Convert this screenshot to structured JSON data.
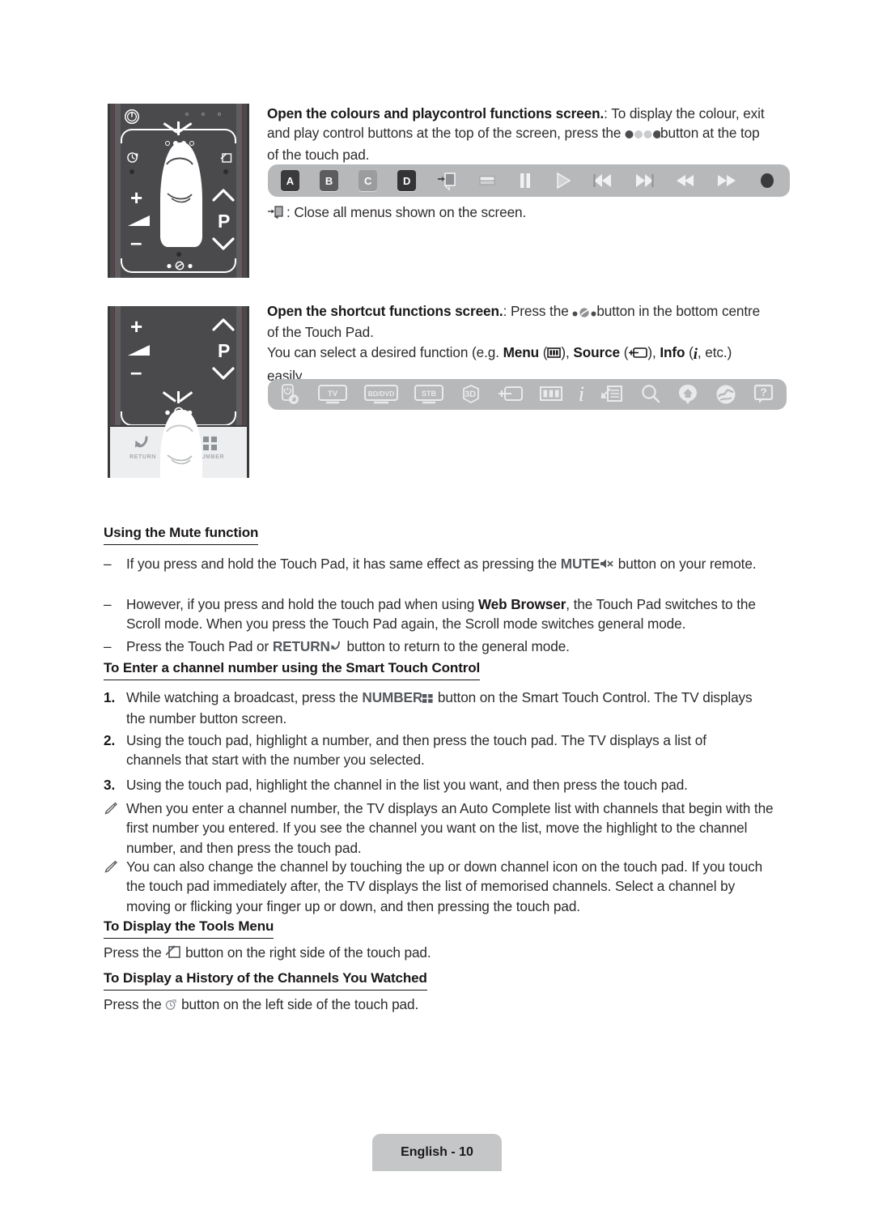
{
  "document": {
    "language": "English",
    "page_number": "10",
    "footer_label": "English - 10"
  },
  "sections": [
    {
      "id": "colours-playcontrol",
      "heading_bold": "Open the colours and playcontrol functions screen.",
      "text_after_heading": ": To display the colour, exit and play control buttons at the top of the screen, press the",
      "text_tail": "button at the top of the touch pad.",
      "inline_icon": "four-dot-button-icon",
      "note": ": Close all menus shown on the screen.",
      "note_icon": "exit-door-icon",
      "bar": {
        "name": "colours-and-playcontrol-bar",
        "items": [
          {
            "name": "button-a",
            "label": "A",
            "kind": "letter",
            "tone": "a"
          },
          {
            "name": "button-b",
            "label": "B",
            "kind": "letter",
            "tone": "b"
          },
          {
            "name": "button-c",
            "label": "C",
            "kind": "letter",
            "tone": "c"
          },
          {
            "name": "button-d",
            "label": "D",
            "kind": "letter",
            "tone": "d"
          },
          {
            "name": "exit-icon",
            "label": "",
            "kind": "exit"
          },
          {
            "name": "stop-icon",
            "label": "",
            "kind": "stop"
          },
          {
            "name": "pause-icon",
            "label": "",
            "kind": "pause"
          },
          {
            "name": "play-icon",
            "label": "",
            "kind": "play"
          },
          {
            "name": "previous-icon",
            "label": "",
            "kind": "prev"
          },
          {
            "name": "next-icon",
            "label": "",
            "kind": "next"
          },
          {
            "name": "rewind-icon",
            "label": "",
            "kind": "rew"
          },
          {
            "name": "fast-forward-icon",
            "label": "",
            "kind": "ff"
          },
          {
            "name": "record-icon",
            "label": "",
            "kind": "record"
          }
        ]
      }
    },
    {
      "id": "shortcut-functions",
      "heading_bold": "Open the shortcut functions screen.",
      "text_after_heading": ": Press the",
      "text_tail": "button in the bottom centre of the Touch Pad.",
      "inline_icon": "three-dot-button-icon",
      "line2_a": "You can select a desired function (e.g. ",
      "line2_menu": "Menu",
      "line2_menu_icon": "menu-icon",
      "line2_source": "Source",
      "line2_source_icon": "source-icon",
      "line2_info": "Info",
      "line2_info_icon": "info-icon",
      "line2_tail": ", etc.) easily.",
      "bar": {
        "name": "shortcut-functions-bar",
        "items": [
          {
            "name": "power-settings-icon",
            "label": "",
            "kind": "powerset"
          },
          {
            "name": "tv-icon",
            "label": "TV",
            "kind": "device"
          },
          {
            "name": "bd-dvd-icon",
            "label": "BD/DVD",
            "kind": "device"
          },
          {
            "name": "stb-icon",
            "label": "STB",
            "kind": "device"
          },
          {
            "name": "three-d-icon",
            "label": "3D",
            "kind": "threed"
          },
          {
            "name": "source-icon",
            "label": "",
            "kind": "source"
          },
          {
            "name": "menu-icon",
            "label": "",
            "kind": "menu"
          },
          {
            "name": "info-icon",
            "label": "i",
            "kind": "info"
          },
          {
            "name": "channel-list-icon",
            "label": "",
            "kind": "chlist"
          },
          {
            "name": "search-icon",
            "label": "",
            "kind": "search"
          },
          {
            "name": "smart-hub-icon",
            "label": "",
            "kind": "hub"
          },
          {
            "name": "web-browser-icon",
            "label": "",
            "kind": "web"
          },
          {
            "name": "support-help-icon",
            "label": "?",
            "kind": "help"
          }
        ]
      }
    }
  ],
  "mute_section": {
    "heading": "Using the Mute function",
    "items": [
      {
        "marker": "–",
        "pre": "If you press and hold the Touch Pad, it has same effect as pressing the ",
        "bold": "MUTE",
        "icon": "mute-icon",
        "post": " button on your remote."
      },
      {
        "marker": "–",
        "pre": "However, if you press and hold the touch pad when using ",
        "bold": "Web Browser",
        "icon": "",
        "post": ", the Touch Pad switches to the Scroll mode. When you press the Touch Pad again, the Scroll mode switches general mode."
      },
      {
        "marker": "–",
        "pre": "Press the Touch Pad or ",
        "bold": "RETURN",
        "icon": "return-icon",
        "post": " button to return to the general mode."
      }
    ]
  },
  "channel_section": {
    "heading": "To Enter a channel number using the Smart Touch Control",
    "items": [
      {
        "marker": "1.",
        "pre": "While watching a broadcast, press the ",
        "bold": "NUMBER",
        "icon": "number-grid-icon",
        "post": " button on the Smart Touch Control. The TV displays the number button screen."
      },
      {
        "marker": "2.",
        "pre": "Using the touch pad, highlight a number, and then press the touch pad. The TV displays a list of channels that start with the number you selected.",
        "bold": "",
        "icon": "",
        "post": ""
      },
      {
        "marker": "3.",
        "pre": " Using the touch pad, highlight the channel in the list you want, and then press the touch pad.",
        "bold": "",
        "icon": "",
        "post": ""
      }
    ],
    "notes": [
      {
        "marker": "note-pencil-icon",
        "text": "When you enter a channel number, the TV displays an Auto Complete list with channels that begin with the first number you entered. If you see the channel you want on the list, move the highlight to the channel number, and then press the touch pad."
      },
      {
        "marker": "note-pencil-icon",
        "text": "You can also change the channel by touching the up or down channel icon on the touch pad. If you touch the touch pad immediately after, the TV displays the list of memorised channels. Select a channel by moving or flicking your finger up or down, and then pressing the touch pad."
      }
    ]
  },
  "tools_section": {
    "heading": "To Display the Tools Menu",
    "pre": "Press the ",
    "icon": "tools-icon",
    "post": " button on the right side of the touch pad."
  },
  "history_section": {
    "heading": "To Display a History of the Channels You Watched",
    "pre": "Press the ",
    "icon": "recent-history-icon",
    "post": " button on the left side of the touch pad."
  },
  "remotes": [
    {
      "name": "remote-top-touchpad-illustration",
      "labels": {
        "vol_up": "+",
        "vol_down": "–",
        "p": "P"
      },
      "icons": [
        "power-icon",
        "recent-history-icon",
        "tools-icon",
        "volume-icon",
        "channel-up-icon",
        "channel-down-icon",
        "four-dot-button-icon",
        "three-dot-button-icon",
        "finger-icon"
      ]
    },
    {
      "name": "remote-bottom-touchpad-illustration",
      "labels": {
        "vol_up": "+",
        "vol_down": "–",
        "p": "P",
        "return": "RETURN",
        "number": "NUMBER"
      },
      "icons": [
        "volume-icon",
        "channel-up-icon",
        "channel-down-icon",
        "three-dot-button-icon",
        "return-icon",
        "number-grid-icon",
        "finger-icon"
      ]
    }
  ],
  "colors": {
    "remote_body": "#4a4a4c",
    "remote_bottom_panel": "#eceef0",
    "icon_bar": "#b6b8ba",
    "footer_pill": "#c4c6c8",
    "text": "#2e2b2c"
  }
}
